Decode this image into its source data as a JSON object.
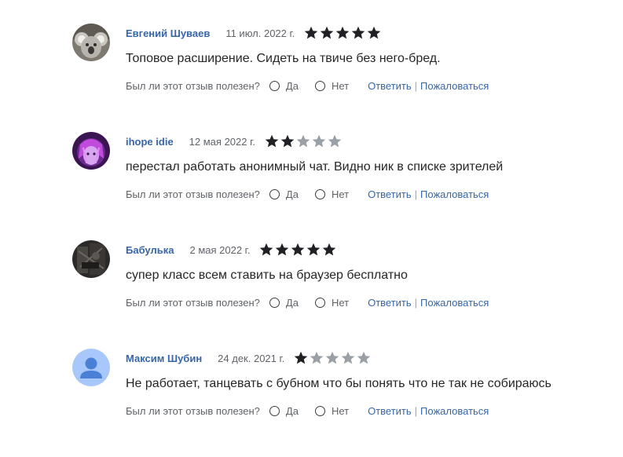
{
  "helpful_question": "Был ли этот отзыв полезен?",
  "yes_label": "Да",
  "no_label": "Нет",
  "reply_label": "Ответить",
  "separator": "|",
  "report_label": "Пожаловаться",
  "colors": {
    "link": "#3766a8",
    "star_filled": "#202124",
    "star_empty": "#9aa0a6"
  },
  "reviews": [
    {
      "author": "Евгений Шуваев",
      "date": "11 июл. 2022 г.",
      "rating": 5,
      "text": "Топовое расширение. Сидеть на твиче без него-бред.",
      "avatar": "koala-photo"
    },
    {
      "author": "ihope idie",
      "date": "12 мая 2022 г.",
      "rating": 2,
      "text": "перестал работать анонимный чат. Видно ник в списке зрителей",
      "avatar": "purple-anime-photo"
    },
    {
      "author": "Бабулька",
      "date": "2 мая 2022 г.",
      "rating": 5,
      "text": "супер класс всем ставить на браузер бесплатно",
      "avatar": "dark-photo"
    },
    {
      "author": "Максим Шубин",
      "date": "24 дек. 2021 г.",
      "rating": 1,
      "text": "Не работает, танцевать с бубном что бы понять что не так не собираюсь",
      "avatar": "default-user-icon"
    }
  ]
}
